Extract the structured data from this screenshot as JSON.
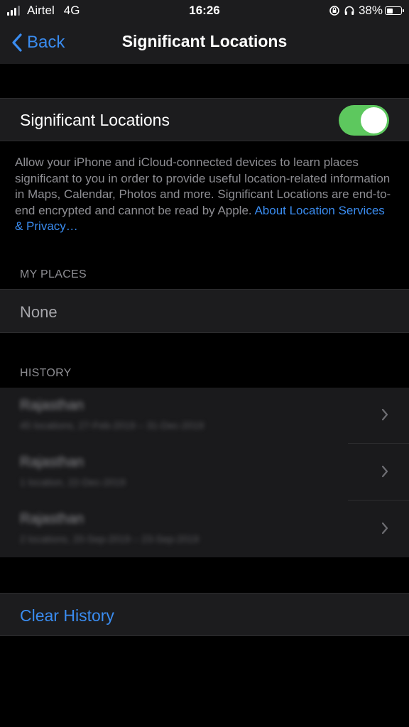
{
  "status_bar": {
    "carrier": "Airtel",
    "network": "4G",
    "time": "16:26",
    "battery_percent": "38%",
    "battery_level": 0.38,
    "icons": [
      "signal-icon",
      "orientation-lock-icon",
      "headphones-icon",
      "battery-icon"
    ]
  },
  "nav": {
    "back_label": "Back",
    "title": "Significant Locations"
  },
  "toggle": {
    "label": "Significant Locations",
    "on": true,
    "color": "#5dc85e"
  },
  "description": {
    "text": "Allow your iPhone and iCloud-connected devices to learn places significant to you in order to provide useful location-related information in Maps, Calendar, Photos and more. Significant Locations are end-to-end encrypted and cannot be read by Apple.",
    "link": "About Location Services & Privacy…"
  },
  "my_places": {
    "header": "MY PLACES",
    "value": "None"
  },
  "history": {
    "header": "HISTORY",
    "items": [
      {
        "title": "Rajasthan",
        "subtitle": "45 locations, 27-Feb-2019 – 31-Dec-2019"
      },
      {
        "title": "Rajasthan",
        "subtitle": "1 location, 22-Dec-2019"
      },
      {
        "title": "Rajasthan",
        "subtitle": "2 locations, 20-Sep-2019 – 23-Sep-2019"
      }
    ]
  },
  "clear_history": {
    "label": "Clear History"
  },
  "colors": {
    "accent": "#3a8cf0",
    "background": "#000000",
    "cell": "#1c1c1e"
  }
}
